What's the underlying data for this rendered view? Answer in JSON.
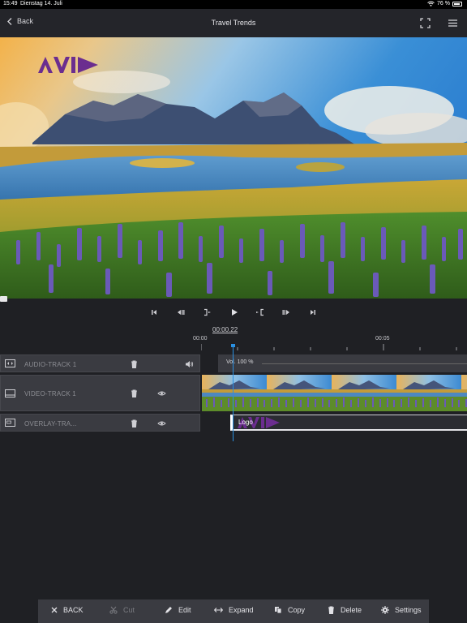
{
  "status": {
    "time": "15:49",
    "date": "Dienstag 14. Juli",
    "battery": "76 %"
  },
  "nav": {
    "back_label": "Back",
    "title": "Travel Trends"
  },
  "preview": {
    "watermark_icon": "avid-logo"
  },
  "transport": {
    "buttons": [
      "go-to-start",
      "step-back",
      "mark-in",
      "play",
      "mark-out",
      "step-forward",
      "go-to-end"
    ]
  },
  "timeline": {
    "timecode": "00:00.22",
    "tick_labels": [
      "00:00",
      "00:05"
    ],
    "tracks": [
      {
        "name": "AUDIO-TRACK 1",
        "aux_icon": "speaker-icon"
      },
      {
        "name": "VIDEO-TRACK 1",
        "aux_icon": "eye-icon"
      },
      {
        "name": "OVERLAY-TRA...",
        "aux_icon": "eye-icon"
      }
    ],
    "audio_clip": {
      "volume_label": "Vol. 100 %"
    },
    "overlay_clip": {
      "label": "Logo"
    }
  },
  "toolbar": {
    "back": "BACK",
    "cut": "Cut",
    "edit": "Edit",
    "expand": "Expand",
    "copy": "Copy",
    "delete": "Delete",
    "settings": "Settings"
  },
  "colors": {
    "accent_playhead": "#2a8fe0",
    "avid_purple": "#6b2d8f",
    "background": "#1f2024",
    "track_header": "#3a3b41"
  }
}
